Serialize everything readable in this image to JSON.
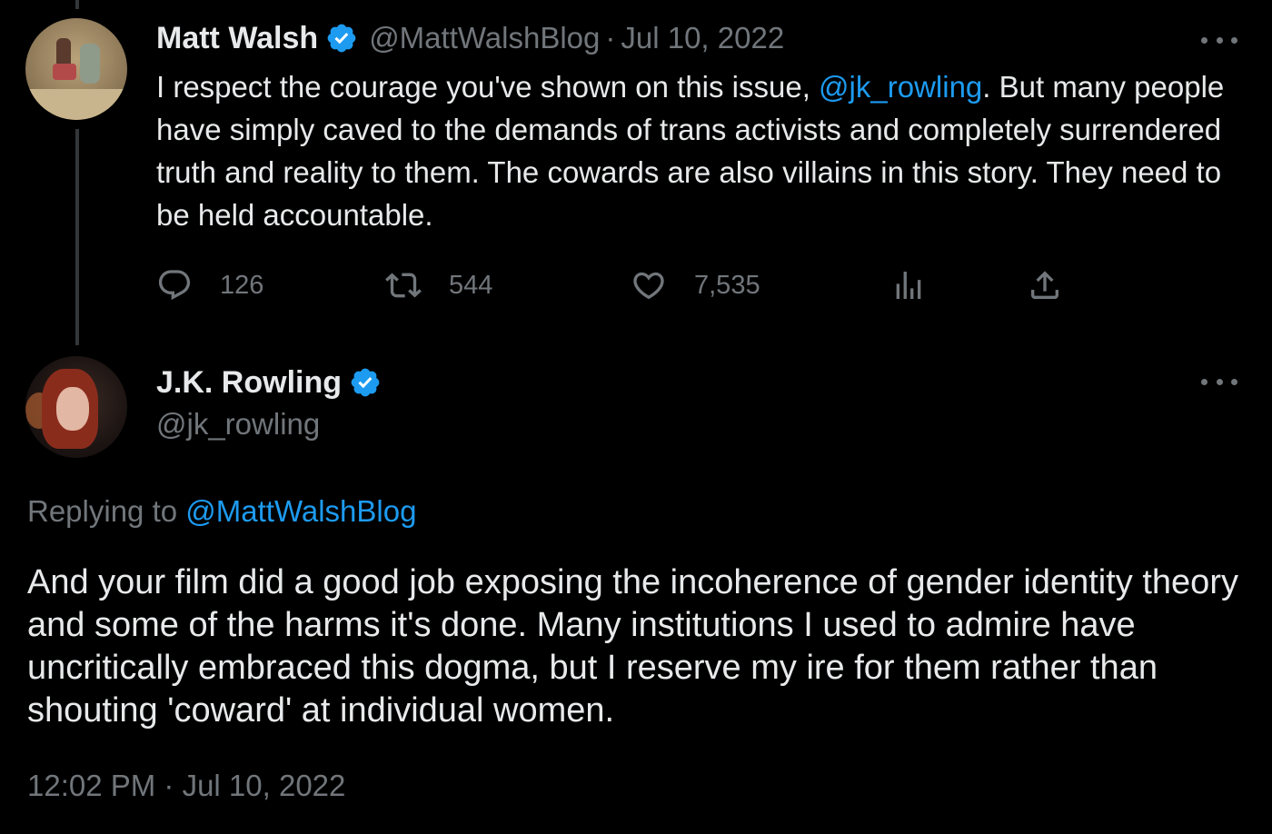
{
  "thread": {
    "parent_tweet": {
      "author_name": "Matt Walsh",
      "handle": "@MattWalshBlog",
      "separator": "·",
      "date": "Jul 10, 2022",
      "text_before_mention": "I respect the courage you've shown on this issue, ",
      "mention": "@jk_rowling",
      "text_after_mention": ". But many people have simply caved to the demands of trans activists and completely surrendered truth and reality to them. The cowards are also villains in this story. They need to be held accountable.",
      "stats": {
        "replies": "126",
        "retweets": "544",
        "likes": "7,535"
      }
    },
    "main_tweet": {
      "author_name": "J.K. Rowling",
      "handle": "@jk_rowling",
      "replying_to_label": "Replying to ",
      "replying_to_handle": "@MattWalshBlog",
      "text": "And your film did a good job exposing the incoherence of gender identity theory and some of the harms it's done. Many institutions I used to admire have uncritically embraced this dogma, but I reserve my ire for them rather than shouting 'coward' at individual women.",
      "timestamp": "12:02 PM · Jul 10, 2022"
    }
  },
  "icons": {
    "verified": "verified-badge-icon",
    "more": "more-options-icon",
    "reply": "reply-icon",
    "retweet": "retweet-icon",
    "like": "heart-icon",
    "views": "views-icon",
    "share": "share-icon"
  },
  "colors": {
    "background": "#000000",
    "text": "#e7e9ea",
    "muted": "#71767b",
    "accent": "#1d9bf0",
    "thread_line": "#333639"
  }
}
